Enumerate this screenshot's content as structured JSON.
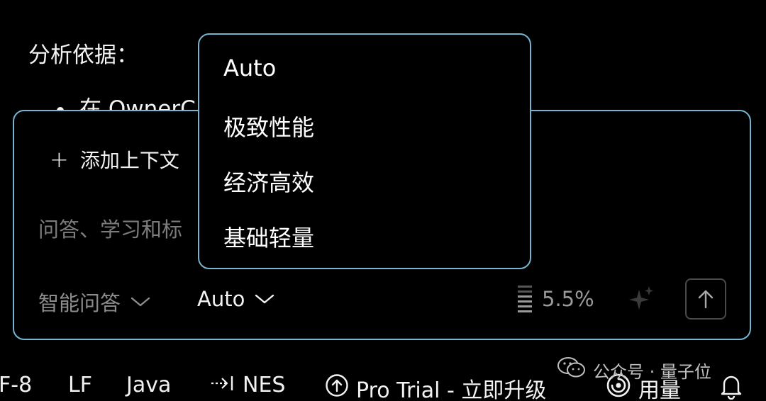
{
  "background": {
    "heading": "分析依据：",
    "bullet_text": "在 OwnerC                                     orm 方法内部通"
  },
  "chat_panel": {
    "add_context_label": "添加上下文",
    "input_placeholder": "问答、学习和标",
    "mode_selector_label": "智能问答",
    "model_selector_label": "Auto",
    "context_usage": "5.5%"
  },
  "model_dropdown": {
    "options": [
      "Auto",
      "极致性能",
      "经济高效",
      "基础轻量"
    ]
  },
  "status_bar": {
    "encoding": "F-8",
    "line_ending": "LF",
    "language": "Java",
    "nes_label": "NES",
    "pro_trial_label": "Pro Trial - 立即升级",
    "usage_label": "用量"
  },
  "watermark": {
    "text": "公众号 · 量子位"
  },
  "colors": {
    "accent_border": "#78b4cf",
    "background": "#000000",
    "text_primary": "#ffffff",
    "text_muted": "#7c7c7c"
  }
}
